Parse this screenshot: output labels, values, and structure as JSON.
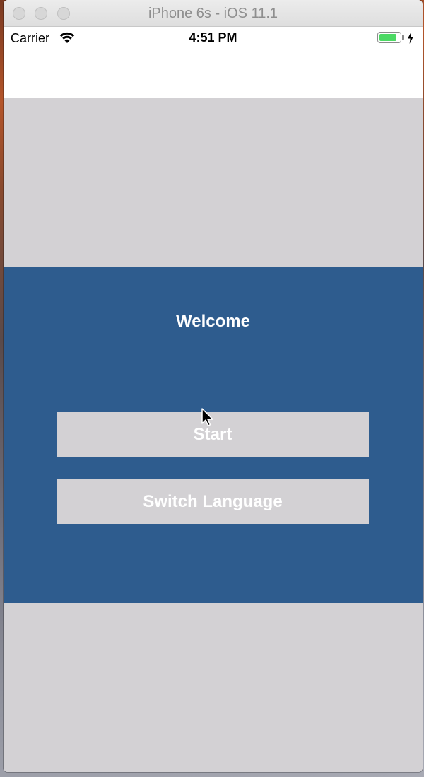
{
  "window": {
    "title": "iPhone 6s - iOS 11.1"
  },
  "status_bar": {
    "carrier": "Carrier",
    "time": "4:51 PM",
    "wifi_icon": "wifi-icon",
    "battery_icon": "battery-icon",
    "battery_level": 0.85,
    "charging_icon": "bolt-icon",
    "battery_color": "#4cd964"
  },
  "main": {
    "welcome": "Welcome",
    "start_label": "Start",
    "switch_language_label": "Switch Language"
  },
  "colors": {
    "panel": "#2e5c8e",
    "background": "#d3d1d4",
    "button": "#d3d1d4",
    "button_text": "#ffffff"
  }
}
